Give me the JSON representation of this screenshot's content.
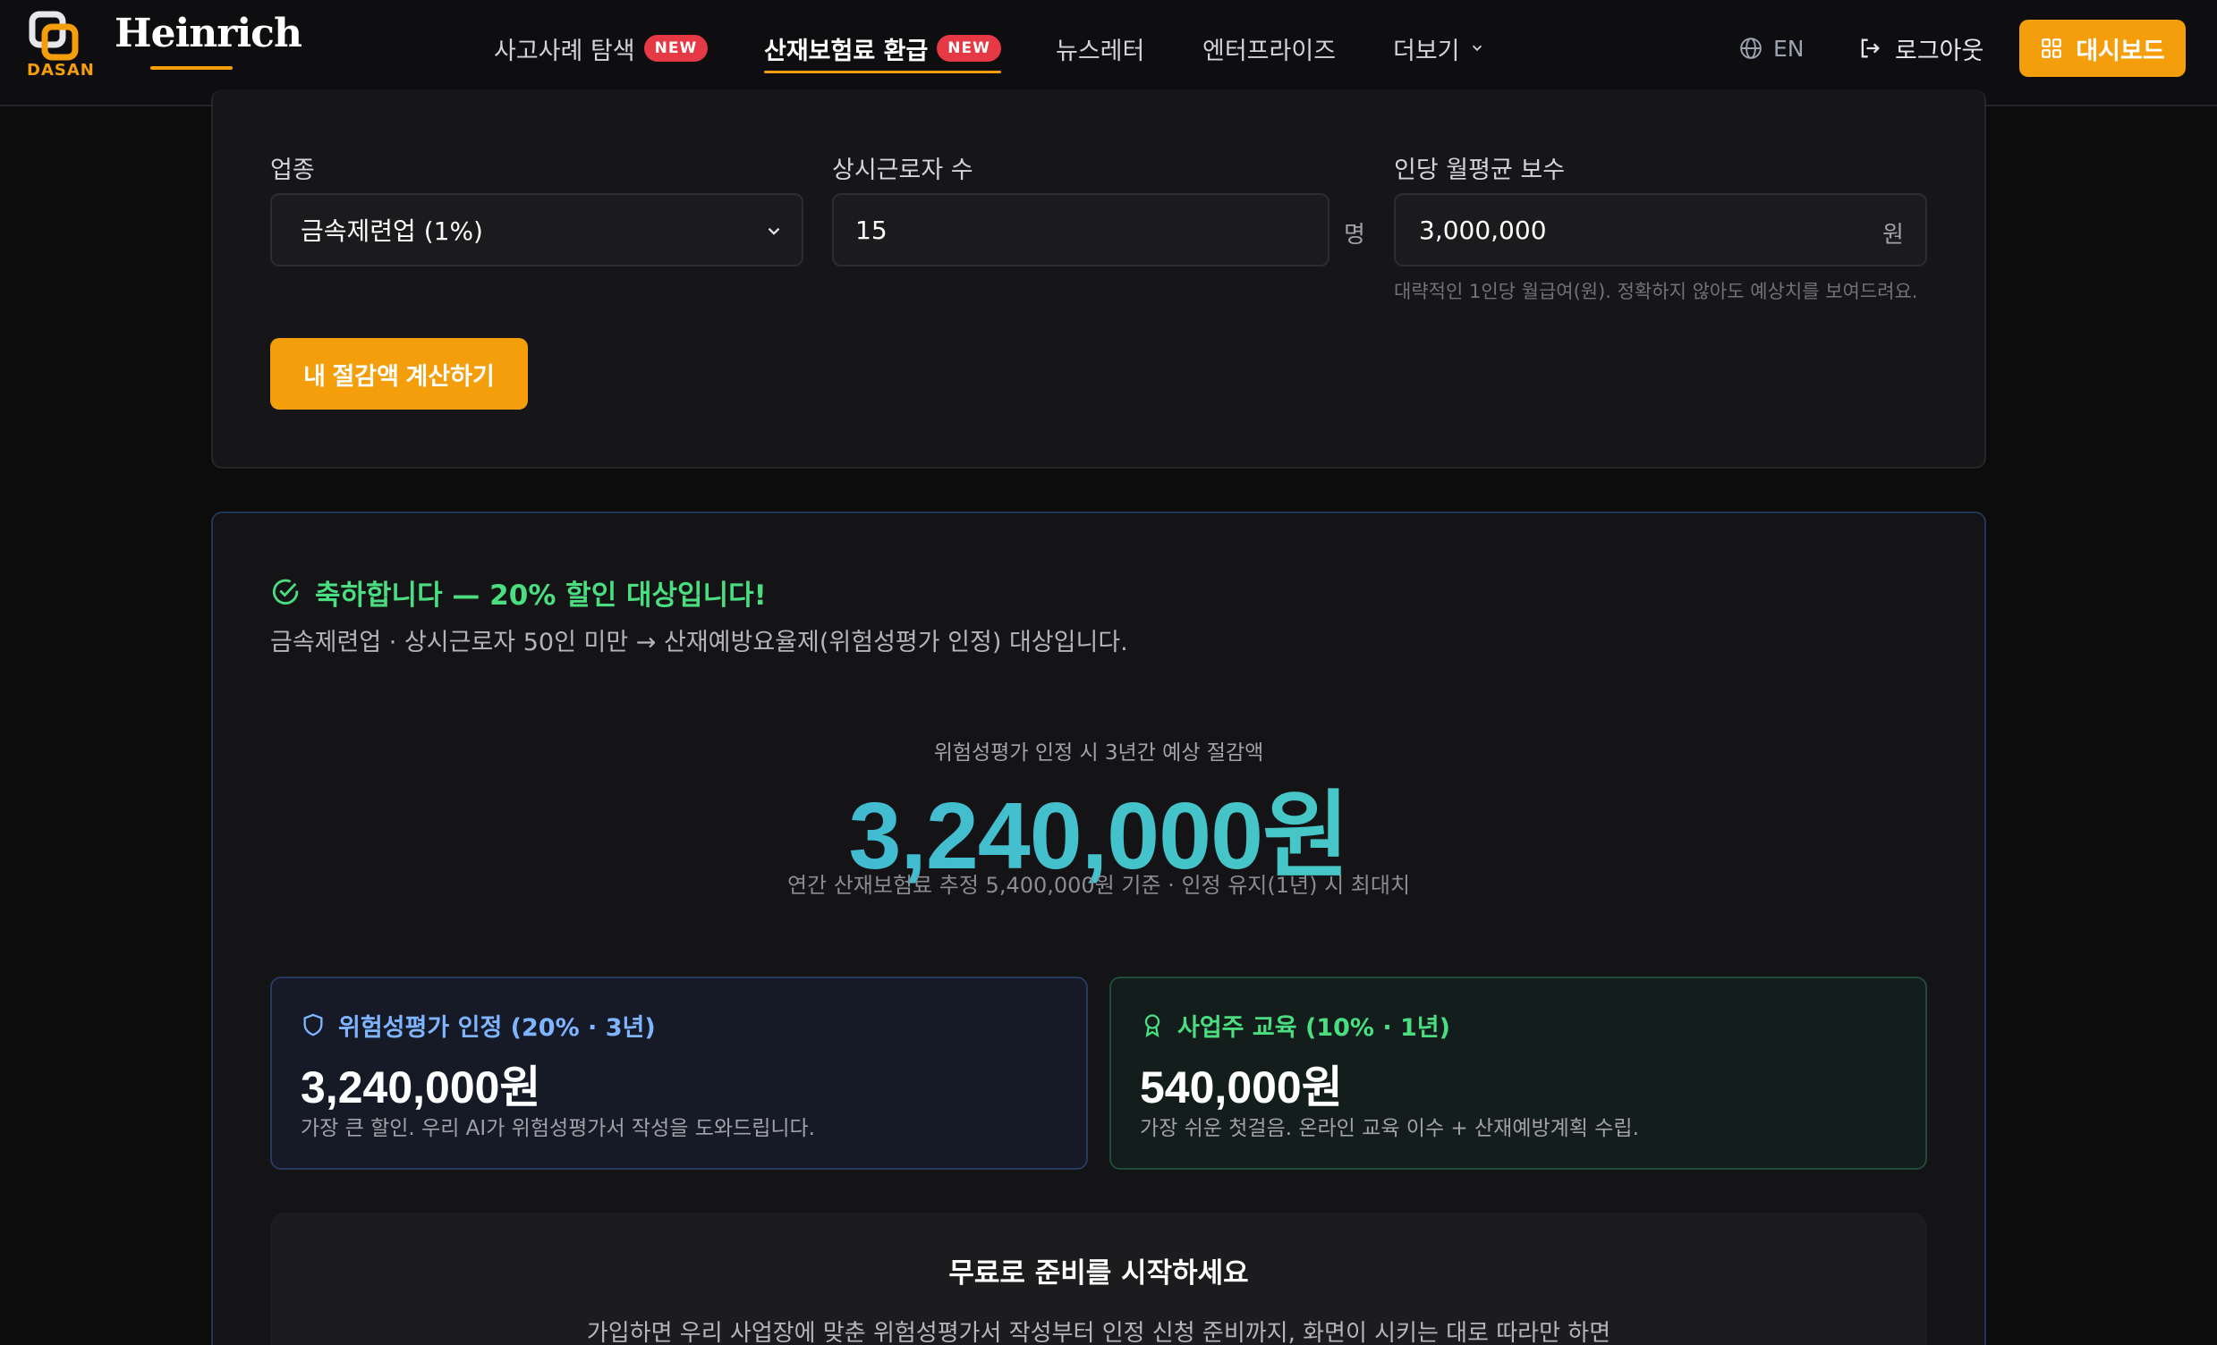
{
  "nav": {
    "logo_text": "DASAN",
    "brand": "Heinrich",
    "items": [
      {
        "label": "사고사례 탐색",
        "badge": "NEW"
      },
      {
        "label": "산재보험료 환급",
        "badge": "NEW"
      },
      {
        "label": "뉴스레터"
      },
      {
        "label": "엔터프라이즈"
      },
      {
        "label": "더보기"
      }
    ],
    "lang": "EN",
    "logout": "로그아웃",
    "dashboard": "대시보드"
  },
  "form": {
    "industry_label": "업종",
    "industry_value": "금속제련업 (1%)",
    "workers_label": "상시근로자 수",
    "workers_value": "15",
    "workers_unit": "명",
    "salary_label": "인당 월평균 보수",
    "salary_value": "3,000,000",
    "salary_unit": "원",
    "salary_hint": "대략적인 1인당 월급여(원). 정확하지 않아도 예상치를 보여드려요.",
    "calc_button": "내 절감액 계산하기"
  },
  "result": {
    "congrats": "축하합니다 — 20% 할인 대상입니다!",
    "congrats_sub": "금속제련업 · 상시근로자 50인 미만 → 산재예방요율제(위험성평가 인정) 대상입니다.",
    "caption": "위험성평가 인정 시 3년간 예상 절감액",
    "amount": "3,240,000원",
    "note": "연간 산재보험료 추정 5,400,000원 기준 · 인정 유지(1년) 시 최대치",
    "cards": [
      {
        "title": "위험성평가 인정 (20% · 3년)",
        "amount": "3,240,000원",
        "desc": "가장 큰 할인. 우리 AI가 위험성평가서 작성을 도와드립니다."
      },
      {
        "title": "사업주 교육 (10% · 1년)",
        "amount": "540,000원",
        "desc": "가장 쉬운 첫걸음. 온라인 교육 이수 + 산재예방계획 수립."
      }
    ]
  },
  "cta": {
    "title": "무료로 준비를 시작하세요",
    "desc": "가입하면 우리 사업장에 맞춘 위험성평가서 작성부터 인정 신청 준비까지, 화면이 시키는 대로 따라만 하면"
  },
  "colors": {
    "accent": "#f59e0b",
    "badge": "#e53945",
    "success": "#4ade80",
    "info": "#7fb4ff"
  }
}
